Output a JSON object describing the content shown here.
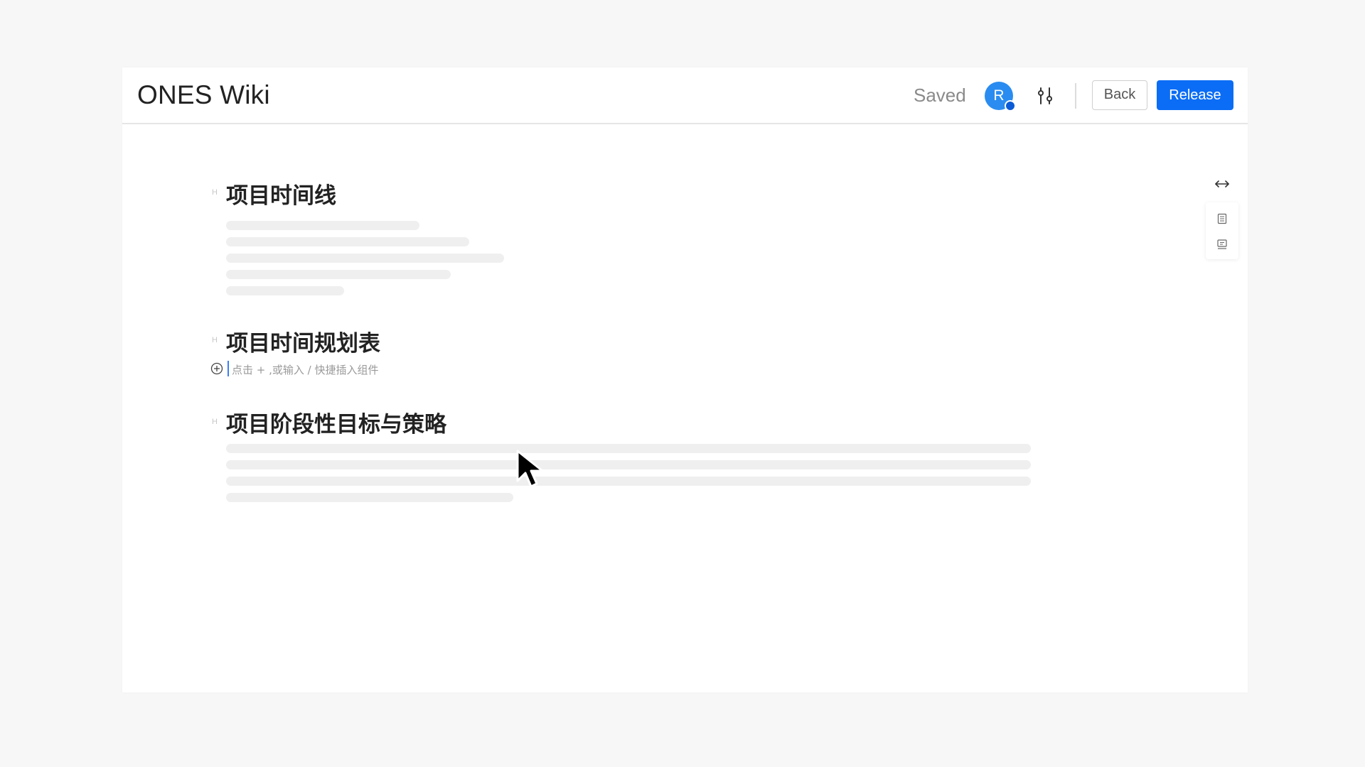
{
  "header": {
    "app_title": "ONES Wiki",
    "status": "Saved",
    "avatar_initial": "R",
    "back_label": "Back",
    "release_label": "Release"
  },
  "document": {
    "heading_marker": "H",
    "sections": [
      {
        "heading": "项目时间线"
      },
      {
        "heading": "项目时间规划表"
      },
      {
        "heading": "项目阶段性目标与策略"
      }
    ],
    "insert_placeholder": "点击 + ,或输入 / 快捷插入组件"
  },
  "icons": {
    "settings": "sliders-icon",
    "add": "plus-circle-icon",
    "expand": "expand-width-icon",
    "outline": "document-outline-icon",
    "comments": "comment-icon",
    "pointer": "mouse-pointer-icon"
  },
  "colors": {
    "primary": "#0b6df5",
    "avatar": "#2a8cf0",
    "skeleton": "#efefef"
  }
}
